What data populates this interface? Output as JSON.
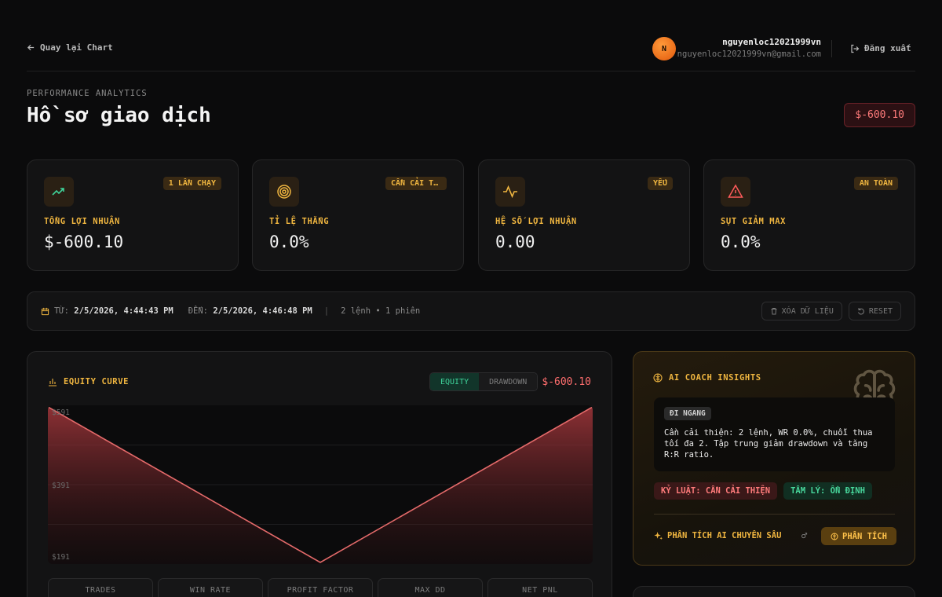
{
  "header": {
    "back_label": "Quay lại Chart",
    "user_initial": "N",
    "user_name": "nguyenloc12021999vn",
    "user_email": "nguyenloc12021999vn@gmail.com",
    "logout_label": "Đăng xuất"
  },
  "page": {
    "eyebrow": "PERFORMANCE ANALYTICS",
    "title": "Hồ sơ giao dịch",
    "total_pnl": "$-600.10"
  },
  "stats": [
    {
      "label": "TỔNG LỢI NHUẬN",
      "value": "$-600.10",
      "badge": "1 LẦN CHẠY",
      "icon": "trending-up-icon",
      "icon_color": "#3fd39a"
    },
    {
      "label": "TỈ LỆ THẮNG",
      "value": "0.0%",
      "badge": "CẦN CẢI THIỆN",
      "icon": "target-icon",
      "icon_color": "#f0b640"
    },
    {
      "label": "HỆ SỐ LỢI NHUẬN",
      "value": "0.00",
      "badge": "YẾU",
      "icon": "activity-icon",
      "icon_color": "#f0b640"
    },
    {
      "label": "SỤT GIẢM MAX",
      "value": "0.0%",
      "badge": "AN TOÀN",
      "icon": "alert-triangle-icon",
      "icon_color": "#ff5b5b"
    }
  ],
  "range": {
    "from_label": "TỪ:",
    "from_value": "2/5/2026, 4:44:43 PM",
    "to_label": "ĐẾN:",
    "to_value": "2/5/2026, 4:46:48 PM",
    "separator": "|",
    "summary": "2 lệnh • 1 phiên",
    "clear_label": "XÓA DỮ LIỆU",
    "reset_label": "RESET"
  },
  "equity": {
    "title": "EQUITY CURVE",
    "tab_equity": "EQUITY",
    "tab_drawdown": "DRAWDOWN",
    "value": "$-600.10",
    "metrics": [
      "TRADES",
      "WIN RATE",
      "PROFIT FACTOR",
      "MAX DD",
      "NET PNL"
    ]
  },
  "chart_data": {
    "type": "area",
    "x": [
      0,
      1,
      2
    ],
    "values": [
      591,
      191,
      591
    ],
    "y_tick_labels": [
      "$591",
      "$391",
      "$191"
    ],
    "y_ticks": [
      591,
      391,
      191
    ],
    "ylim": [
      191,
      591
    ],
    "line_color": "#e46a6a",
    "grid": true
  },
  "coach": {
    "title": "AI COACH INSIGHTS",
    "mode_tag": "ĐI NGANG",
    "insight": "Cần cải thiện: 2 lệnh, WR 0.0%, chuỗi thua tối đa 2. Tập trung giảm drawdown và tăng R:R ratio.",
    "tag_discipline": "KỶ LUẬT: CẦN CẢI THIỆN",
    "tag_psychology": "TÂM LÝ: ỔN ĐỊNH",
    "deep_label": "PHÂN TÍCH AI CHUYÊN SÂU",
    "gender_symbol": "♂",
    "analyze_label": "PHÂN TÍCH"
  }
}
